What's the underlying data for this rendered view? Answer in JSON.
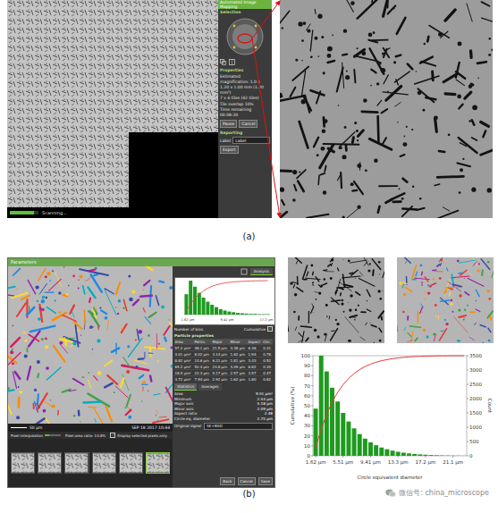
{
  "panel_a": {
    "caption": "(a)",
    "mapping_window": {
      "title": "Automated Image Mapping",
      "selection_label": "Selection",
      "properties_label": "Properties",
      "properties": [
        "Estimated magnification: 1.0 x",
        "1.20 x 1.00 mm (1.20 mm²)",
        "7 x 6 tiles (42 tiles)",
        "Tile overlap 10%",
        "Time remaining 00:08:20"
      ],
      "buttons": [
        "Pause",
        "Cancel"
      ],
      "reporting_label": "Reporting",
      "label_field": {
        "label": "Label",
        "value": "Label"
      },
      "export_button": "Export",
      "status": {
        "text": "Scanning...",
        "level": 0.85
      }
    }
  },
  "panel_b": {
    "caption": "(b)",
    "analysis_window": {
      "title": "Parameters",
      "tab": "Analysis",
      "mini_chart": {
        "counts": [
          60,
          100,
          82,
          64,
          50,
          38,
          29,
          22,
          16,
          12,
          9,
          7,
          5,
          4,
          3,
          2,
          2,
          1,
          1,
          1
        ],
        "cumulative": [
          11.8,
          31.5,
          47.6,
          60.2,
          70.1,
          77.6,
          83.3,
          87.6,
          90.7,
          93.1,
          94.9,
          96.3,
          97.2,
          98.0,
          98.6,
          99.0,
          99.4,
          99.6,
          99.8,
          100
        ],
        "x_ticks": [
          "1.62 μm",
          "9.41 μm",
          "17.2 μm"
        ]
      },
      "bins_label": "Number of bins",
      "cumulative": {
        "label": "Cumulative",
        "checked": true
      },
      "table": {
        "title": "Particle properties",
        "columns": [
          "Area",
          "Perim.",
          "Major",
          "Minor",
          "Aspect",
          "Circ."
        ],
        "rows": [
          [
            "57.2 μm²",
            "48.1 μm",
            "21.5 μm",
            "3.38 μm",
            "6.36",
            "0.31"
          ],
          [
            "4.01 μm²",
            "8.02 μm",
            "3.14 μm",
            "1.62 μm",
            "1.94",
            "0.78"
          ],
          [
            "8.82 μm²",
            "14.6 μm",
            "6.21 μm",
            "1.81 μm",
            "3.43",
            "0.52"
          ],
          [
            "65.2 μm²",
            "52.4 μm",
            "23.8 μm",
            "3.49 μm",
            "6.82",
            "0.30"
          ],
          [
            "18.5 μm²",
            "22.3 μm",
            "9.17 μm",
            "2.57 μm",
            "3.57",
            "0.47"
          ],
          [
            "3.72 μm²",
            "7.54 μm",
            "2.92 μm",
            "1.62 μm",
            "1.80",
            "0.82"
          ]
        ]
      },
      "stat_tabs": [
        {
          "label": "Statistics",
          "selected": true
        },
        {
          "label": "Averages",
          "selected": false
        }
      ],
      "stats": [
        {
          "label": "Area",
          "value": "9.51 μm²"
        },
        {
          "label": "Minimum",
          "value": "2.53 μm"
        },
        {
          "label": "Major axis",
          "value": "5.18 μm"
        },
        {
          "label": "Minor axis",
          "value": "2.09 μm"
        },
        {
          "label": "Aspect ratio",
          "value": "2.48"
        },
        {
          "label": "Circle eq. diameter",
          "value": "2.75 μm"
        }
      ],
      "signal": {
        "label": "Original signal",
        "value": "SE+BSD"
      },
      "buttons": [
        "Back",
        "Cancel",
        "Save"
      ],
      "scale": "50 μm",
      "date": "SEP 18 2017 10:44",
      "settings": [
        {
          "kind": "slider",
          "label": "Pixel interpolation",
          "level": 0.3
        },
        {
          "kind": "text",
          "label": "Pixel area ratio: 14.8%"
        },
        {
          "kind": "checkbox",
          "label": "Display selected pixels only",
          "checked": true
        }
      ],
      "thumbnails": [
        {
          "selected": false
        },
        {
          "selected": false
        },
        {
          "selected": false
        },
        {
          "selected": false
        },
        {
          "selected": false
        },
        {
          "selected": true
        }
      ]
    },
    "chart": {
      "x_title": "Circle equivalent diameter",
      "left_title": "Cumulative (%)",
      "right_title": "Count",
      "x_ticks": [
        "1.62 μm",
        "5.51 μm",
        "9.41 μm",
        "13.3 μm",
        "17.2 μm",
        "21.1 μm"
      ],
      "left_ticks": [
        "0",
        "10",
        "20",
        "30",
        "40",
        "50",
        "60",
        "70",
        "80",
        "90",
        "100"
      ],
      "right_ticks": [
        "0",
        "500",
        "1000",
        "1500",
        "2000",
        "2500",
        "3000",
        "3500"
      ],
      "series": [
        {
          "name": "Count",
          "color": "#1e9a1e",
          "values": [
            1650,
            3500,
            2950,
            2380,
            1900,
            1500,
            1200,
            960,
            760,
            600,
            470,
            370,
            290,
            230,
            180,
            140,
            110,
            85,
            65,
            50,
            38,
            28,
            20,
            14,
            10,
            7,
            5,
            3
          ]
        },
        {
          "name": "Cumulative",
          "color": "#e53935",
          "values": [
            8.5,
            26.4,
            41.5,
            53.7,
            63.4,
            71.1,
            77.3,
            82.2,
            86.1,
            89.2,
            91.6,
            93.5,
            95.0,
            96.1,
            97.1,
            97.8,
            98.3,
            98.8,
            99.1,
            99.4,
            99.6,
            99.7,
            99.8,
            99.9,
            99.9,
            100,
            100,
            100
          ]
        }
      ]
    }
  },
  "watermark": "微信号: china_microscope"
}
